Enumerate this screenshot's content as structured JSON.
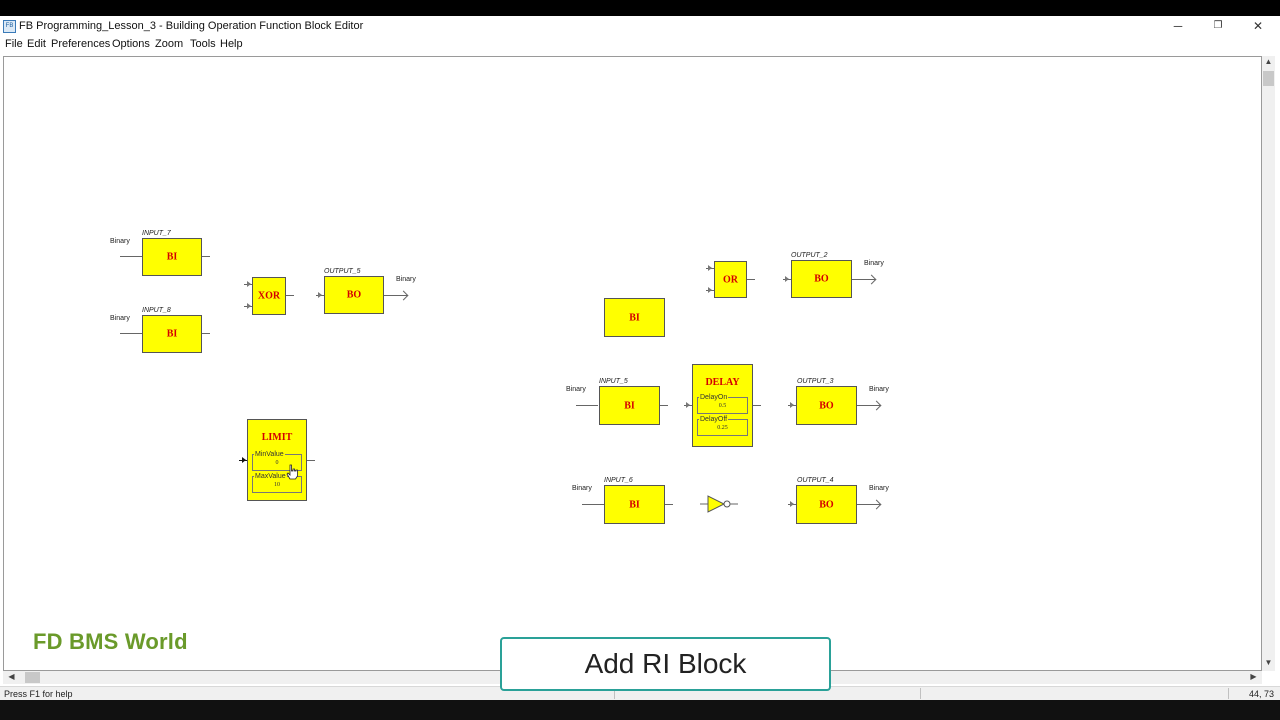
{
  "window": {
    "title": "FB Programming_Lesson_3 - Building Operation Function Block Editor",
    "icon_text": "FB",
    "minimize": "─",
    "restore": "❐",
    "close": "✕"
  },
  "menu": {
    "items": [
      "File",
      "Edit",
      "Preferences",
      "Options",
      "Zoom",
      "Tools",
      "Help"
    ]
  },
  "blocks": {
    "input7": {
      "name": "INPUT_7",
      "type": "BI",
      "io": "Binary"
    },
    "input8": {
      "name": "INPUT_8",
      "type": "BI",
      "io": "Binary"
    },
    "xor": {
      "type": "XOR"
    },
    "output5": {
      "name": "OUTPUT_5",
      "type": "BO",
      "io": "Binary"
    },
    "limit": {
      "type": "LIMIT",
      "p1_name": "MinValue",
      "p1_value": "0",
      "p2_name": "MaxValue",
      "p2_value": "10"
    },
    "or": {
      "type": "OR"
    },
    "output2": {
      "name": "OUTPUT_2",
      "type": "BO",
      "io": "Binary"
    },
    "bi_free": {
      "type": "BI"
    },
    "input5": {
      "name": "INPUT_5",
      "type": "BI",
      "io": "Binary"
    },
    "delay": {
      "type": "DELAY",
      "p1_name": "DelayOn",
      "p1_value": "0.5",
      "p2_name": "DelayOff",
      "p2_value": "0.25"
    },
    "output3": {
      "name": "OUTPUT_3",
      "type": "BO",
      "io": "Binary"
    },
    "input6": {
      "name": "INPUT_6",
      "type": "BI",
      "io": "Binary"
    },
    "output4": {
      "name": "OUTPUT_4",
      "type": "BO",
      "io": "Binary"
    }
  },
  "status": {
    "help": "Press F1 for help",
    "coords": "44, 73"
  },
  "overlay": {
    "watermark": "FD BMS World",
    "caption": "Add RI Block"
  },
  "colors": {
    "block_fill": "#ffff00",
    "block_text": "#d40000",
    "watermark": "#6a9a2a",
    "caption_border": "#2aa198"
  }
}
